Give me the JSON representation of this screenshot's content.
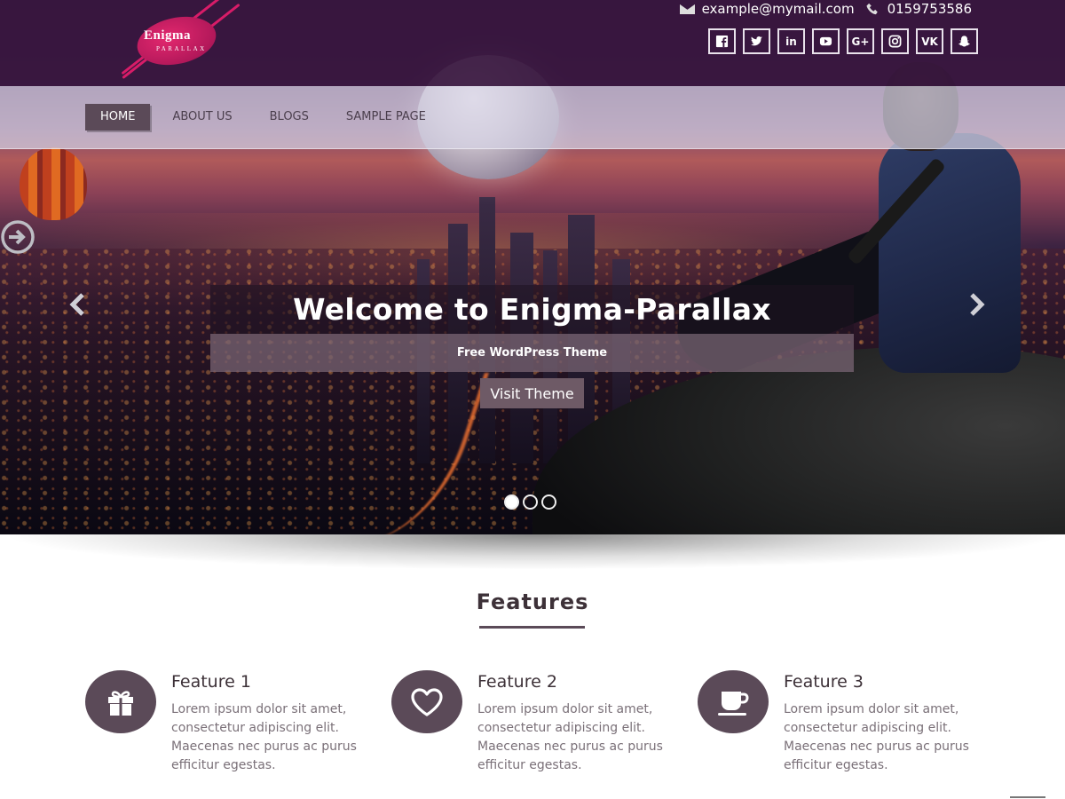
{
  "header": {
    "logo": {
      "name": "Enigma",
      "sub": "PARALLAX"
    },
    "email": "example@mymail.com",
    "phone": "0159753586",
    "socials": [
      {
        "icon": "facebook-icon"
      },
      {
        "icon": "twitter-icon"
      },
      {
        "icon": "linkedin-icon",
        "glyph": "in"
      },
      {
        "icon": "youtube-icon"
      },
      {
        "icon": "google-plus-icon",
        "glyph": "G+"
      },
      {
        "icon": "instagram-icon"
      },
      {
        "icon": "vk-icon",
        "glyph": "VK"
      },
      {
        "icon": "snapchat-icon"
      }
    ]
  },
  "nav": {
    "items": [
      "HOME",
      "ABOUT US",
      "BLOGS",
      "SAMPLE PAGE"
    ],
    "active_index": 0
  },
  "slider": {
    "title": "Welcome to Enigma-Parallax",
    "subtitle": "Free WordPress Theme",
    "button": "Visit Theme",
    "slides": 3,
    "current": 0
  },
  "features": {
    "heading": "Features",
    "items": [
      {
        "title": "Feature 1",
        "text": "Lorem ipsum dolor sit amet, consectetur adipiscing elit. Maecenas nec purus ac purus efficitur egestas.",
        "icon": "gift-icon"
      },
      {
        "title": "Feature 2",
        "text": "Lorem ipsum dolor sit amet, consectetur adipiscing elit. Maecenas nec purus ac purus efficitur egestas.",
        "icon": "heart-icon"
      },
      {
        "title": "Feature 3",
        "text": "Lorem ipsum dolor sit amet, consectetur adipiscing elit. Maecenas nec purus ac purus efficitur egestas.",
        "icon": "coffee-cup-icon"
      }
    ]
  },
  "colors": {
    "topbar": "#37163e",
    "accent": "#5b4a58"
  }
}
